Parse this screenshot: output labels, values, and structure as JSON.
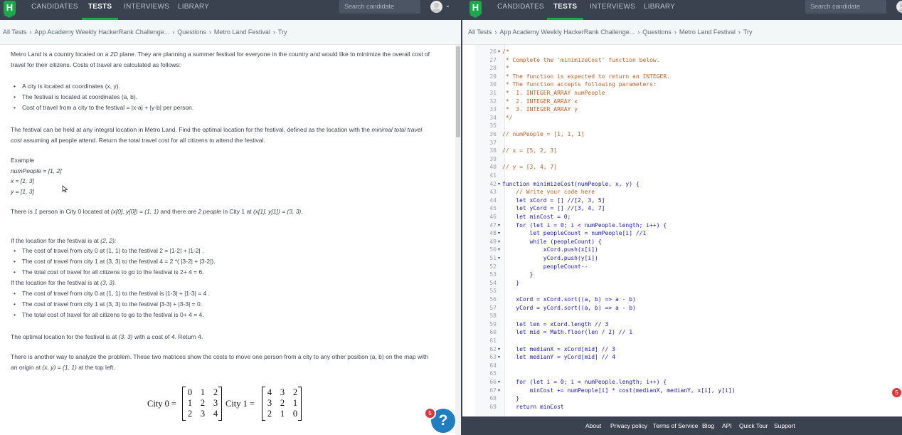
{
  "nav": {
    "logo": "H",
    "items": [
      "CANDIDATES",
      "TESTS",
      "INTERVIEWS",
      "LIBRARY"
    ],
    "active": "TESTS",
    "search_placeholder": "Search candidate",
    "caret": "⌄"
  },
  "breadcrumb": [
    "All Tests",
    "App Academy Weekly HackerRank Challenge...",
    "Questions",
    "Metro Land Festival",
    "Try"
  ],
  "breadcrumb_sep": "›",
  "problem": {
    "intro_a": "Metro Land is a country located on a ",
    "intro_2d": "2D",
    "intro_b": " plane. They are planning a summer festival for everyone in the country and would like to minimize the overall cost of travel for their citizens. Costs of travel are calculated as follows:",
    "bullets": [
      "A city is located at coordinates (x, y).",
      "The festival is located at coordinates (a, b).",
      "Cost of travel from a city to the festival = |x-a| + |y-b| per person."
    ],
    "para2_a": "The festival can be held at any integral location in Metro Land. Find the optimal location for the festival, defined as the location with the ",
    "para2_em": "minimal total travel cost",
    "para2_b": " assuming all people attend. Return the total travel cost for all citizens to attend the festival.",
    "example_heading": "Example",
    "example_lines": [
      "numPeople = [1, 2]",
      "x = [1, 3]",
      "y = [1, 3]"
    ],
    "persons_a": "There is ",
    "persons_1": "1",
    "persons_b": " person in City 0 located at ",
    "persons_c0": "(x[0], y[0]) = (1, 1)",
    "persons_d": " and there are ",
    "persons_2": "2 people",
    "persons_e": " in City 1 at ",
    "persons_c1": "(x[1], y[1]) = (3, 3).",
    "loc1_a": "If the location for the festival is at ",
    "loc1_b": "(2, 2):",
    "loc1_bullets": [
      "The cost of travel from city 0 at (1, 1) to the festival 2 = |1-2| + |1-2| .",
      "The cost of travel from city 1 at (3, 3) to the festival 4 = 2 *( |3-2| + |3-2|).",
      "The total cost of travel for all citizens to go to the festival is 2+ 4 = 6."
    ],
    "loc2_a": "If the location for the festival is at ",
    "loc2_b": "(3, 3).",
    "loc2_bullets": [
      "The cost of travel from city 0 at (1, 1) to the festival is |1-3| + |1-3| = 4 .",
      "The cost of travel from city 1 at (3, 3) to the festival |3-3| + |3-3| = 0.",
      "The total cost of travel for all citizens to go to the festival is 0+ 4 = 4."
    ],
    "optimal_a": "The optimal location for the festival is at ",
    "optimal_b": "(3, 3)",
    "optimal_c": " with a cost of ",
    "optimal_d": "4",
    "optimal_e": ". Return 4.",
    "another_a": "There is another way to analyze the problem. These two matrices show the costs to move one person from a city to any other position (a, b) on the map with an origin at ",
    "another_b": "(x, y) = (1, 1)",
    "another_c": " at the top left.",
    "city0_label": "City 0 =",
    "city1_label": "City 1 =",
    "city0": [
      [
        "0",
        "1",
        "2"
      ],
      [
        "1",
        "2",
        "3"
      ],
      [
        "2",
        "3",
        "4"
      ]
    ],
    "city1": [
      [
        "4",
        "3",
        "2"
      ],
      [
        "3",
        "2",
        "1"
      ],
      [
        "2",
        "1",
        "0"
      ]
    ]
  },
  "help": {
    "label": "?",
    "badge": "5"
  },
  "right_badge": "5",
  "code": {
    "lines": [
      {
        "n": "26",
        "f": "▾",
        "t": "/*",
        "c": "cm"
      },
      {
        "n": "27",
        "f": "",
        "t": " * Complete the 'minimizeCost' function below.",
        "c": "cm"
      },
      {
        "n": "28",
        "f": "",
        "t": " *",
        "c": "cm"
      },
      {
        "n": "29",
        "f": "",
        "t": " * The function is expected to return an INTEGER.",
        "c": "cm"
      },
      {
        "n": "30",
        "f": "",
        "t": " * The function accepts following parameters:",
        "c": "cm"
      },
      {
        "n": "31",
        "f": "",
        "t": " *  1. INTEGER_ARRAY numPeople",
        "c": "cm"
      },
      {
        "n": "32",
        "f": "",
        "t": " *  2. INTEGER_ARRAY x",
        "c": "cm"
      },
      {
        "n": "33",
        "f": "",
        "t": " *  3. INTEGER_ARRAY y",
        "c": "cm"
      },
      {
        "n": "34",
        "f": "",
        "t": " */",
        "c": "cm"
      },
      {
        "n": "35",
        "f": "",
        "t": "",
        "c": "kw"
      },
      {
        "n": "36",
        "f": "",
        "t": "// numPeople = [1, 1, 1]",
        "c": "cm"
      },
      {
        "n": "37",
        "f": "",
        "t": "",
        "c": "kw"
      },
      {
        "n": "38",
        "f": "",
        "t": "// x = [5, 2, 3]",
        "c": "cm"
      },
      {
        "n": "39",
        "f": "",
        "t": "",
        "c": "kw"
      },
      {
        "n": "40",
        "f": "",
        "t": "// y = [3, 4, 7]",
        "c": "cm"
      },
      {
        "n": "41",
        "f": "",
        "t": "",
        "c": "kw"
      },
      {
        "n": "42",
        "f": "▾",
        "t": "function minimizeCost(numPeople, x, y) {",
        "c": "kw"
      },
      {
        "n": "43",
        "f": "",
        "t": "    // Write your code here",
        "c": "cm"
      },
      {
        "n": "44",
        "f": "",
        "t": "    let xCord = [] //[2, 3, 5]",
        "c": "kw"
      },
      {
        "n": "45",
        "f": "",
        "t": "    let yCord = [] //[3, 4, 7]",
        "c": "kw"
      },
      {
        "n": "46",
        "f": "",
        "t": "    let minCost = 0;",
        "c": "kw"
      },
      {
        "n": "47",
        "f": "▾",
        "t": "    for (let i = 0; i < numPeople.length; i++) {",
        "c": "kw"
      },
      {
        "n": "48",
        "f": "▾",
        "t": "        let peopleCount = numPeople[i] //1",
        "c": "kw"
      },
      {
        "n": "49",
        "f": "▾",
        "t": "        while (peopleCount) {",
        "c": "kw"
      },
      {
        "n": "50",
        "f": "▾",
        "t": "            xCord.push(x[i])",
        "c": "kw"
      },
      {
        "n": "51",
        "f": "▾",
        "t": "            yCord.push(y[i])",
        "c": "kw"
      },
      {
        "n": "52",
        "f": "",
        "t": "            peopleCount--",
        "c": "kw"
      },
      {
        "n": "53",
        "f": "",
        "t": "        }",
        "c": "kw"
      },
      {
        "n": "54",
        "f": "",
        "t": "    }",
        "c": "kw"
      },
      {
        "n": "55",
        "f": "",
        "t": "",
        "c": "kw"
      },
      {
        "n": "56",
        "f": "",
        "t": "    xCord = xCord.sort((a, b) => a - b)",
        "c": "kw"
      },
      {
        "n": "57",
        "f": "",
        "t": "    yCord = yCord.sort((a, b) => a - b)",
        "c": "kw"
      },
      {
        "n": "58",
        "f": "",
        "t": "",
        "c": "kw"
      },
      {
        "n": "59",
        "f": "",
        "t": "    let len = xCord.length // 3",
        "c": "kw"
      },
      {
        "n": "60",
        "f": "",
        "t": "    let mid = Math.floor(len / 2) // 1",
        "c": "kw"
      },
      {
        "n": "61",
        "f": "",
        "t": "",
        "c": "kw"
      },
      {
        "n": "62",
        "f": "▾",
        "t": "    let medianX = xCord[mid] // 3",
        "c": "kw"
      },
      {
        "n": "63",
        "f": "▾",
        "t": "    let medianY = yCord[mid] // 4",
        "c": "kw"
      },
      {
        "n": "64",
        "f": "",
        "t": "",
        "c": "kw"
      },
      {
        "n": "65",
        "f": "",
        "t": "",
        "c": "kw"
      },
      {
        "n": "66",
        "f": "▾",
        "t": "    for (let i = 0; i < numPeople.length; i++) {",
        "c": "kw"
      },
      {
        "n": "67",
        "f": "▾",
        "t": "        minCost += numPeople[i] * cost(medianX, medianY, x[i], y[i])",
        "c": "kw"
      },
      {
        "n": "68",
        "f": "",
        "t": "    }",
        "c": "kw"
      },
      {
        "n": "69",
        "f": "",
        "t": "    return minCost",
        "c": "kw"
      },
      {
        "n": "70",
        "f": "",
        "t": "}",
        "c": "kw"
      }
    ]
  },
  "footer": [
    "About",
    "Privacy policy",
    "Terms of Service",
    "Blog",
    "API",
    "Quick Tour",
    "Support"
  ]
}
